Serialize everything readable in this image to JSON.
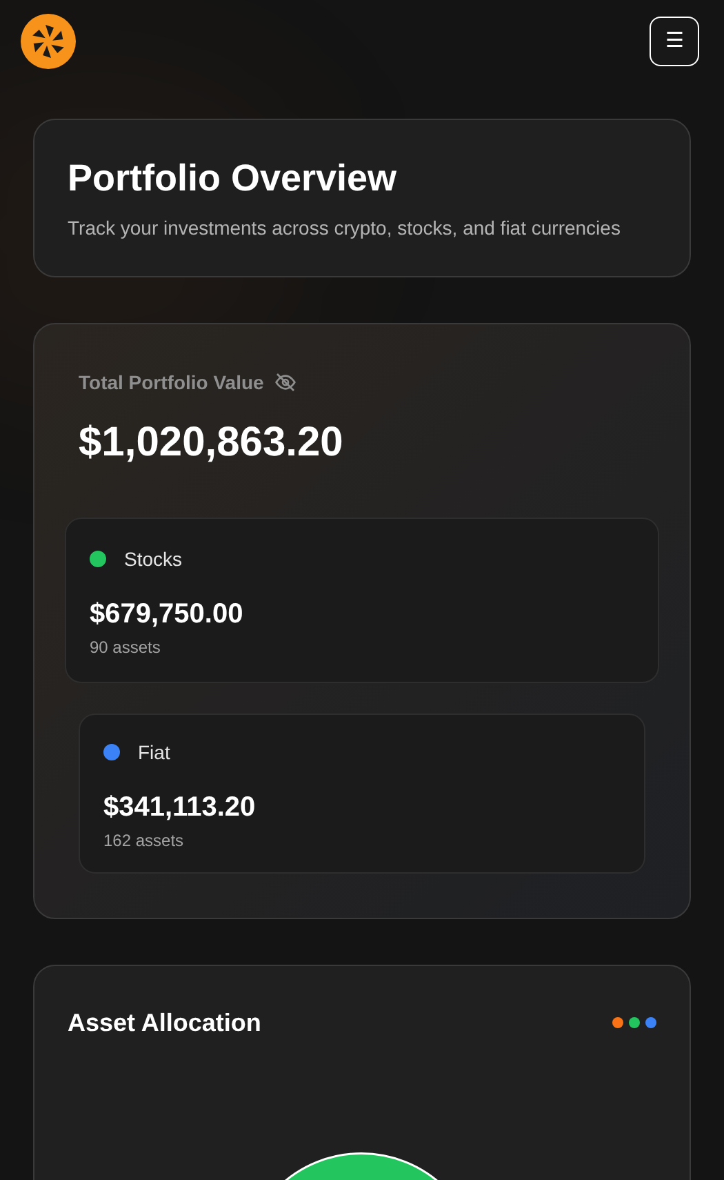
{
  "header": {
    "menu_button": "☰"
  },
  "overview": {
    "title": "Portfolio Overview",
    "subtitle": "Track your investments across crypto, stocks, and fiat currencies"
  },
  "total": {
    "label": "Total Portfolio Value",
    "value": "$1,020,863.20",
    "hidden": false
  },
  "categories": [
    {
      "name": "Stocks",
      "color": "#22c55e",
      "value": "$679,750.00",
      "assets": "90 assets"
    },
    {
      "name": "Fiat",
      "color": "#3b82f6",
      "value": "$341,113.20",
      "assets": "162 assets"
    }
  ],
  "allocation": {
    "title": "Asset Allocation",
    "legend_dots": [
      {
        "color": "#f97316"
      },
      {
        "color": "#22c55e"
      },
      {
        "color": "#3b82f6"
      }
    ]
  }
}
